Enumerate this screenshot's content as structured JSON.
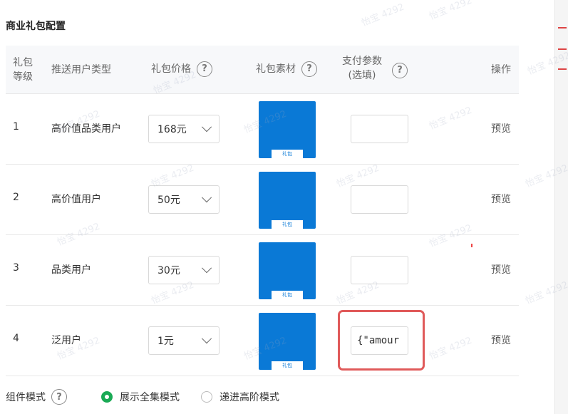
{
  "section": {
    "title": "商业礼包配置"
  },
  "table": {
    "headers": {
      "level_line1": "礼包",
      "level_line2": "等级",
      "user_type": "推送用户类型",
      "price": "礼包价格",
      "material": "礼包素材",
      "pay_param_line1": "支付参数",
      "pay_param_line2": "(选填)",
      "operation": "操作"
    },
    "help_glyph": "?",
    "rows": [
      {
        "level": "1",
        "user_type": "高价值品类用户",
        "price": "168元",
        "pay_param": "",
        "action": "预览"
      },
      {
        "level": "2",
        "user_type": "高价值用户",
        "price": "50元",
        "pay_param": "",
        "action": "预览"
      },
      {
        "level": "3",
        "user_type": "品类用户",
        "price": "30元",
        "pay_param": "",
        "action": "预览"
      },
      {
        "level": "4",
        "user_type": "泛用户",
        "price": "1元",
        "pay_param": "{\"amour",
        "action": "预览"
      }
    ],
    "thumb_label": "礼包"
  },
  "mode": {
    "label": "组件模式",
    "options": [
      {
        "label": "展示全集模式",
        "checked": true
      },
      {
        "label": "递进高阶模式",
        "checked": false
      }
    ]
  },
  "colors": {
    "accent_green": "#1aaa55",
    "thumb_blue": "#0a79d6",
    "highlight_red": "#e05a5a"
  },
  "watermark_text": "怡宝 4292"
}
